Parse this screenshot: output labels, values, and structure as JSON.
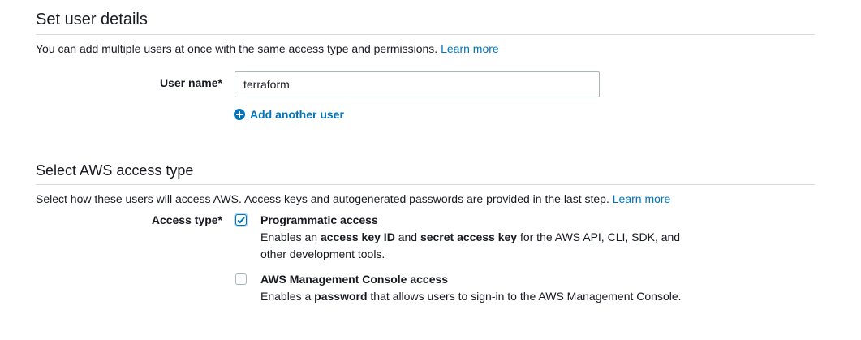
{
  "user_details": {
    "title": "Set user details",
    "description": "You can add multiple users at once with the same access type and permissions.",
    "learn_more": "Learn more",
    "user_name_label": "User name*",
    "user_name_value": "terraform",
    "add_another_user": "Add another user"
  },
  "access_type": {
    "title": "Select AWS access type",
    "description": "Select how these users will access AWS. Access keys and autogenerated passwords are provided in the last step.",
    "learn_more": "Learn more",
    "label": "Access type*",
    "options": [
      {
        "title": "Programmatic access",
        "checked": true,
        "desc_parts": [
          "Enables an ",
          "access key ID",
          " and ",
          "secret access key",
          " for the AWS API, CLI, SDK, and other development tools."
        ]
      },
      {
        "title": "AWS Management Console access",
        "checked": false,
        "desc_parts": [
          "Enables a ",
          "password",
          " that allows users to sign-in to the AWS Management Console."
        ]
      }
    ]
  },
  "colors": {
    "link": "#0073bb",
    "text": "#16191f",
    "border": "#aab7b8"
  },
  "icons": {
    "add": "plus-circle-icon",
    "check": "checkmark-icon"
  }
}
